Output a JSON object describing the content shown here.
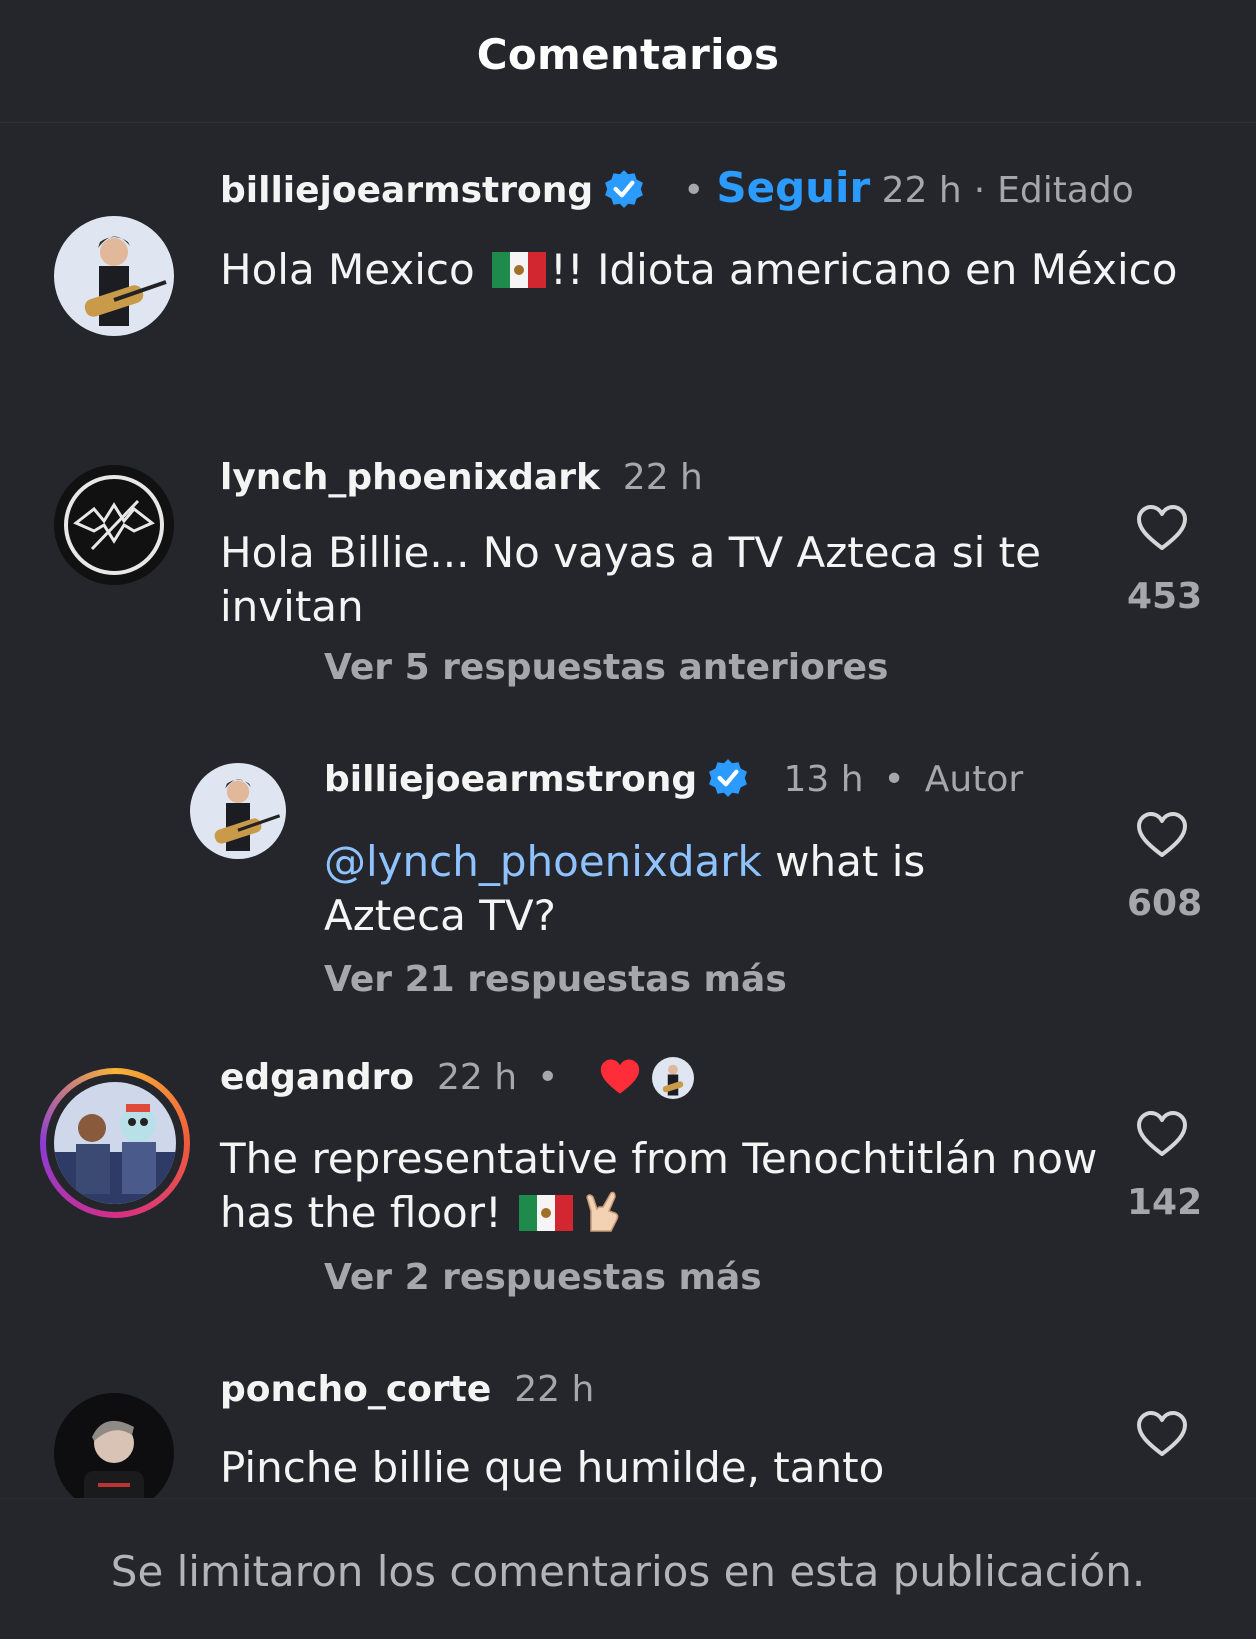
{
  "header": {
    "title": "Comentarios"
  },
  "comments": [
    {
      "username": "billiejoearmstrong",
      "follow_label": "Seguir",
      "time": "22 h",
      "edited": "Editado",
      "text_before": "Hola Mexico ",
      "text_after": "!! Idiota americano en México"
    },
    {
      "username": "lynch_phoenixdark",
      "time": "22 h",
      "text": "Hola Billie... No vayas a TV Azteca si te invitan",
      "likes": "453",
      "replies": "Ver 5 respuestas anteriores"
    },
    {
      "username": "billiejoearmstrong",
      "time": "13 h",
      "author_tag": "Autor",
      "mention": "@lynch_phoenixdark",
      "text": " what is Azteca TV?",
      "likes": "608",
      "replies": "Ver 21 respuestas más"
    },
    {
      "username": "edgandro",
      "time": "22 h",
      "text_before": "The representative from Tenochtitlán now has the floor! ",
      "likes": "142",
      "replies": "Ver 2 respuestas más"
    },
    {
      "username": "poncho_corte",
      "time": "22 h",
      "text": "Pinche billie que humilde, tanto"
    }
  ],
  "footer": {
    "note": "Se limitaron los comentarios en esta publicación."
  },
  "colors": {
    "background": "#25262b",
    "accent": "#2c9bff",
    "mention": "#8fc3ff",
    "like_red": "#ff2d3a"
  }
}
